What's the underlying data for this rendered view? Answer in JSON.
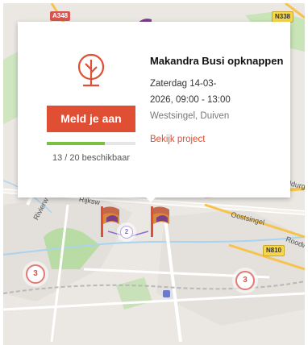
{
  "map": {
    "road_badges": [
      {
        "label": "A348",
        "style": "red"
      },
      {
        "label": "N338",
        "style": "yellow"
      },
      {
        "label": "N810",
        "style": "yellow"
      }
    ],
    "street_labels": [
      "Oostsingel",
      "Roodw",
      "Rijksw",
      "Rivierw",
      "aldurg"
    ],
    "clusters": [
      {
        "count": "3",
        "name": "cluster-left"
      },
      {
        "count": "3",
        "name": "cluster-right"
      },
      {
        "count": "2",
        "name": "cluster-center"
      }
    ]
  },
  "popup": {
    "icon": "tree-icon",
    "title": "Makandra Busi opknappen",
    "date_line1": "Zaterdag 14-03-",
    "date_line2": "2026, 09:00 - 13:00",
    "location": "Westsingel, Duiven",
    "link_label": "Bekijk project",
    "signup_label": "Meld je aan",
    "capacity_text": "13 / 20 beschikbaar",
    "capacity_fraction": 0.65
  },
  "colors": {
    "accent": "#e04f34",
    "capacity_fill": "#7ac143",
    "capacity_track": "#e6e6e6"
  }
}
